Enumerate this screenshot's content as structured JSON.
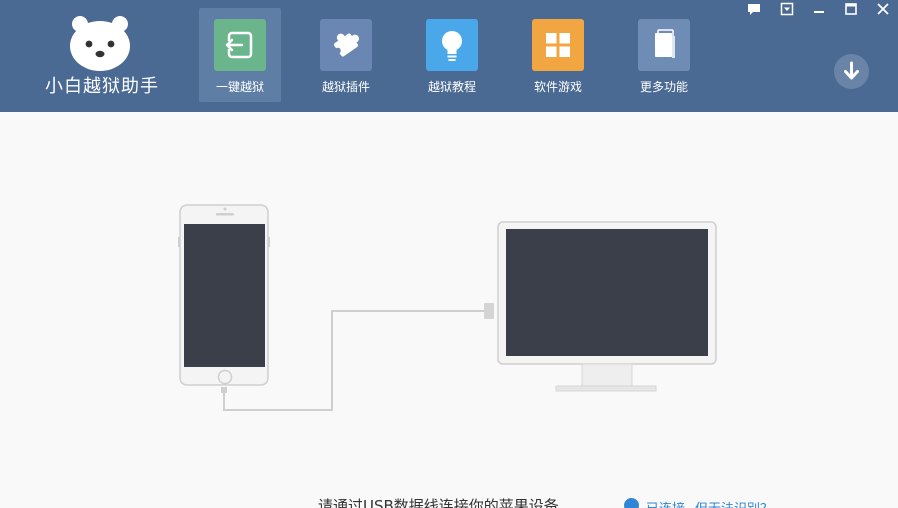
{
  "app": {
    "name": "小白越狱助手"
  },
  "toolbar": {
    "items": [
      {
        "label": "一键越狱",
        "icon": "exit-arrow-icon",
        "color": "#6ab58c",
        "active": true
      },
      {
        "label": "越狱插件",
        "icon": "puzzle-icon",
        "color": "#6a86b2",
        "active": false
      },
      {
        "label": "越狱教程",
        "icon": "lightbulb-icon",
        "color": "#4aa7ea",
        "active": false
      },
      {
        "label": "软件游戏",
        "icon": "grid-apps-icon",
        "color": "#f1a642",
        "active": false
      },
      {
        "label": "更多功能",
        "icon": "book-icon",
        "color": "#6f8cb4",
        "active": false
      }
    ]
  },
  "window_controls": [
    "feedback-icon",
    "menu-icon",
    "minimize-icon",
    "maximize-icon",
    "close-icon"
  ],
  "download": {
    "icon": "download-arrow-icon"
  },
  "status": {
    "prompt": "请通过USB数据线连接你的苹果设备",
    "connected": "已连接",
    "help": "但无法识别？"
  },
  "colors": {
    "header": "#4a6a93",
    "accent": "#2f86d6",
    "screen": "#3b3f49"
  }
}
